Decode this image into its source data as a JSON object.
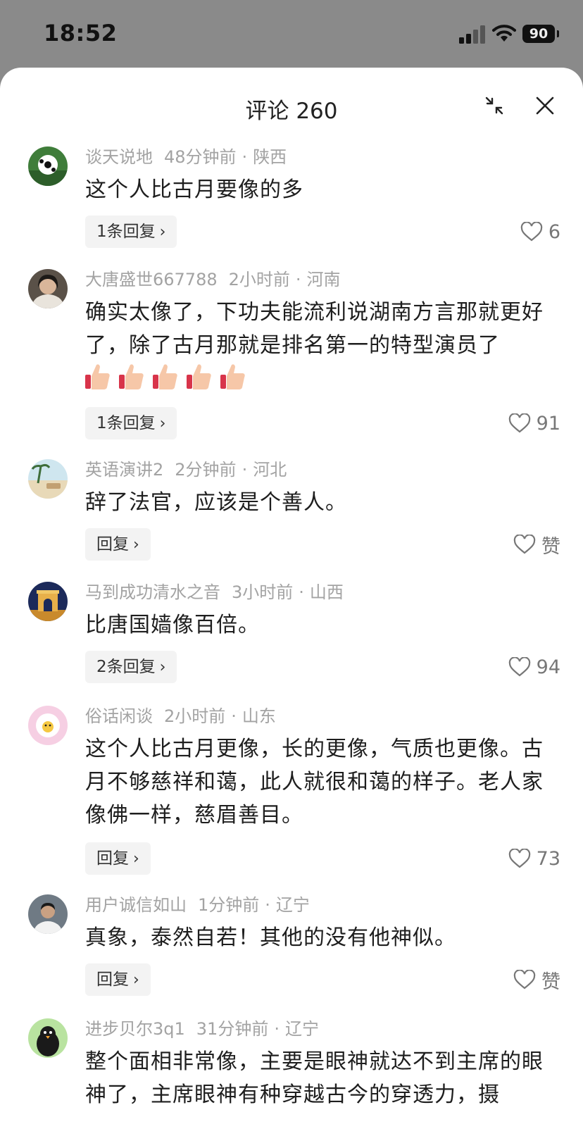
{
  "status": {
    "time": "18:52",
    "battery": "90"
  },
  "sheet": {
    "title": "评论 260"
  },
  "comments": [
    {
      "user": "谈天说地",
      "ago": "48分钟前",
      "region": "陕西",
      "text": "这个人比古月要像的多",
      "reply": "1条回复",
      "likes": "6"
    },
    {
      "user": "大唐盛世667788",
      "ago": "2小时前",
      "region": "河南",
      "text": "确实太像了，下功夫能流利说湖南方言那就更好了，除了古月那就是排名第一的特型演员了",
      "reply": "1条回复",
      "likes": "91"
    },
    {
      "user": "英语演讲2",
      "ago": "2分钟前",
      "region": "河北",
      "text": "辞了法官，应该是个善人。",
      "reply": "回复",
      "likes": "赞"
    },
    {
      "user": "马到成功清水之音",
      "ago": "3小时前",
      "region": "山西",
      "text": "比唐国嫱像百倍。",
      "reply": "2条回复",
      "likes": "94"
    },
    {
      "user": "俗话闲谈",
      "ago": "2小时前",
      "region": "山东",
      "text": "这个人比古月更像，长的更像，气质也更像。古月不够慈祥和蔼，此人就很和蔼的样子。老人家像佛一样，慈眉善目。",
      "reply": "回复",
      "likes": "73"
    },
    {
      "user": "用户诚信如山",
      "ago": "1分钟前",
      "region": "辽宁",
      "text": "真象，泰然自若！其他的没有他神似。",
      "reply": "回复",
      "likes": "赞"
    },
    {
      "user": "进步贝尔3q1",
      "ago": "31分钟前",
      "region": "辽宁",
      "text": "整个面相非常像，主要是眼神就达不到主席的眼神了，主席眼神有种穿越古今的穿透力，摄",
      "reply": "",
      "likes": ""
    }
  ],
  "icons": {
    "collapse": "collapse-icon",
    "close": "close-icon",
    "like": "heart-icon",
    "emoji": "thumbs-up-icon"
  }
}
